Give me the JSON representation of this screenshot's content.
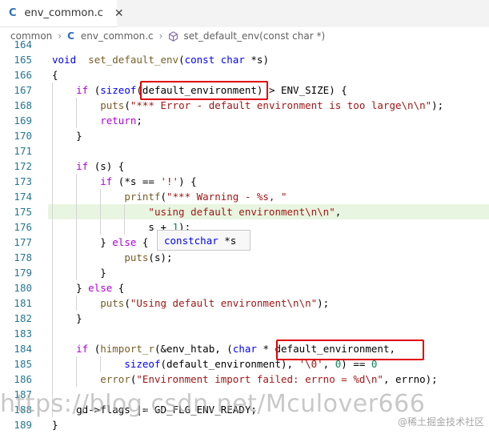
{
  "tab": {
    "label": "env_common.c",
    "close": "✕",
    "icon": "C"
  },
  "breadcrumb": {
    "folder": "common",
    "file": "env_common.c",
    "symbol": "set_default_env(const char *)"
  },
  "tooltip": {
    "type_kw": "const",
    "type": "char",
    "rest": " *s"
  },
  "watermark": "https://blog.csdn.net/Mculover666",
  "watermark2": "@稀土掘金技术社区",
  "lines": [
    {
      "n": "164",
      "parts": []
    },
    {
      "n": "165",
      "parts": [
        [
          "kw",
          "void"
        ],
        [
          "",
          "  "
        ],
        [
          "fn",
          "set_default_env"
        ],
        [
          "",
          "("
        ],
        [
          "kw",
          "const"
        ],
        [
          "",
          " "
        ],
        [
          "kw",
          "char"
        ],
        [
          "",
          " *s)"
        ]
      ]
    },
    {
      "n": "166",
      "parts": [
        [
          "",
          "{"
        ]
      ]
    },
    {
      "n": "167",
      "parts": [
        [
          "",
          "    "
        ],
        [
          "ctl",
          "if"
        ],
        [
          "",
          " ("
        ],
        [
          "kw",
          "sizeof"
        ],
        [
          "",
          "(default_environment) > ENV_SIZE) {"
        ]
      ]
    },
    {
      "n": "168",
      "parts": [
        [
          "",
          "        "
        ],
        [
          "fn",
          "puts"
        ],
        [
          "",
          "("
        ],
        [
          "str",
          "\"*** Error - default environment is too large\\n\\n\""
        ],
        [
          "",
          ");"
        ]
      ]
    },
    {
      "n": "169",
      "parts": [
        [
          "",
          "        "
        ],
        [
          "ctl",
          "return"
        ],
        [
          "",
          ";"
        ]
      ]
    },
    {
      "n": "170",
      "parts": [
        [
          "",
          "    }"
        ]
      ]
    },
    {
      "n": "171",
      "parts": []
    },
    {
      "n": "172",
      "parts": [
        [
          "",
          "    "
        ],
        [
          "ctl",
          "if"
        ],
        [
          "",
          " (s) {"
        ]
      ]
    },
    {
      "n": "173",
      "parts": [
        [
          "",
          "        "
        ],
        [
          "ctl",
          "if"
        ],
        [
          "",
          " (*s == "
        ],
        [
          "str",
          "'!'"
        ],
        [
          "",
          ") {"
        ]
      ]
    },
    {
      "n": "174",
      "parts": [
        [
          "",
          "            "
        ],
        [
          "fn",
          "printf"
        ],
        [
          "",
          "("
        ],
        [
          "str",
          "\"*** Warning - %s, \""
        ]
      ]
    },
    {
      "n": "175",
      "parts": [
        [
          "",
          "                "
        ],
        [
          "str",
          "\"using default environment\\n\\n\""
        ],
        [
          "",
          ","
        ]
      ]
    },
    {
      "n": "176",
      "parts": [
        [
          "",
          "                s + "
        ],
        [
          "num",
          "1"
        ],
        [
          "",
          ");"
        ]
      ]
    },
    {
      "n": "177",
      "parts": [
        [
          "",
          "        } "
        ],
        [
          "ctl",
          "else"
        ],
        [
          "",
          " {"
        ]
      ]
    },
    {
      "n": "178",
      "parts": [
        [
          "",
          "            "
        ],
        [
          "fn",
          "puts"
        ],
        [
          "",
          "(s);"
        ]
      ]
    },
    {
      "n": "179",
      "parts": [
        [
          "",
          "        }"
        ]
      ]
    },
    {
      "n": "180",
      "parts": [
        [
          "",
          "    } "
        ],
        [
          "ctl",
          "else"
        ],
        [
          "",
          " {"
        ]
      ]
    },
    {
      "n": "181",
      "parts": [
        [
          "",
          "        "
        ],
        [
          "fn",
          "puts"
        ],
        [
          "",
          "("
        ],
        [
          "str",
          "\"Using default environment\\n\\n\""
        ],
        [
          "",
          ");"
        ]
      ]
    },
    {
      "n": "182",
      "parts": [
        [
          "",
          "    }"
        ]
      ]
    },
    {
      "n": "183",
      "parts": []
    },
    {
      "n": "184",
      "parts": [
        [
          "",
          "    "
        ],
        [
          "ctl",
          "if"
        ],
        [
          "",
          " ("
        ],
        [
          "fn",
          "himport_r"
        ],
        [
          "",
          "(&env_htab, ("
        ],
        [
          "kw",
          "char"
        ],
        [
          "",
          " * default_environment,"
        ]
      ]
    },
    {
      "n": "185",
      "parts": [
        [
          "",
          "            "
        ],
        [
          "kw",
          "sizeof"
        ],
        [
          "",
          "(default_environment), "
        ],
        [
          "str",
          "'\\0'"
        ],
        [
          "",
          ", "
        ],
        [
          "num",
          "0"
        ],
        [
          "",
          ") == "
        ],
        [
          "num",
          "0"
        ],
        [
          ")"
        ]
      ]
    },
    {
      "n": "186",
      "parts": [
        [
          "",
          "        "
        ],
        [
          "fn",
          "error"
        ],
        [
          "",
          "("
        ],
        [
          "str",
          "\"Environment import failed: errno = %d\\n\""
        ],
        [
          "",
          ", errno);"
        ]
      ]
    },
    {
      "n": "187",
      "parts": []
    },
    {
      "n": "188",
      "parts": [
        [
          "",
          "    gd->flags |= GD_FLG_ENV_READY;"
        ]
      ]
    },
    {
      "n": "189",
      "parts": [
        [
          "",
          "}"
        ]
      ]
    }
  ]
}
